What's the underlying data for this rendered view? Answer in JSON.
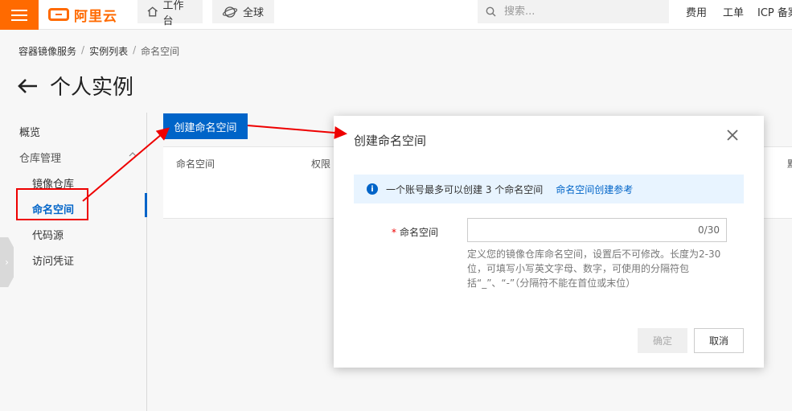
{
  "topbar": {
    "logo_text": "阿里云",
    "workbench_label": "工作台",
    "region_label": "全球",
    "search_placeholder": "搜索...",
    "links": {
      "fee": "费用",
      "ticket": "工单",
      "icp": "ICP 备案"
    },
    "accent_color": "#ff6a00"
  },
  "breadcrumb": [
    "容器镜像服务",
    "实例列表",
    "命名空间"
  ],
  "page": {
    "title": "个人实例"
  },
  "sidebar": {
    "items": [
      {
        "label": "概览"
      },
      {
        "label": "仓库管理"
      },
      {
        "label": "镜像仓库"
      },
      {
        "label": "命名空间",
        "active": true
      },
      {
        "label": "代码源"
      },
      {
        "label": "访问凭证"
      }
    ]
  },
  "main": {
    "create_button": "创建命名空间",
    "table_headers": [
      "命名空间",
      "权限"
    ],
    "truncated_header": "默"
  },
  "dialog": {
    "title": "创建命名空间",
    "notice_text": "一个账号最多可以创建 3 个命名空间",
    "notice_link": "命名空间创建参考",
    "field_required_mark": "*",
    "field_label": "命名空间",
    "field_value": "",
    "counter": "0/30",
    "help_text": "定义您的镜像仓库命名空间，设置后不可修改。长度为2-30位，可填写小写英文字母、数字，可使用的分隔符包括“_”、“-”（分隔符不能在首位或末位）",
    "ok_label": "确定",
    "cancel_label": "取消"
  },
  "colors": {
    "primary": "#0064c8",
    "annotation": "#ee0000"
  }
}
